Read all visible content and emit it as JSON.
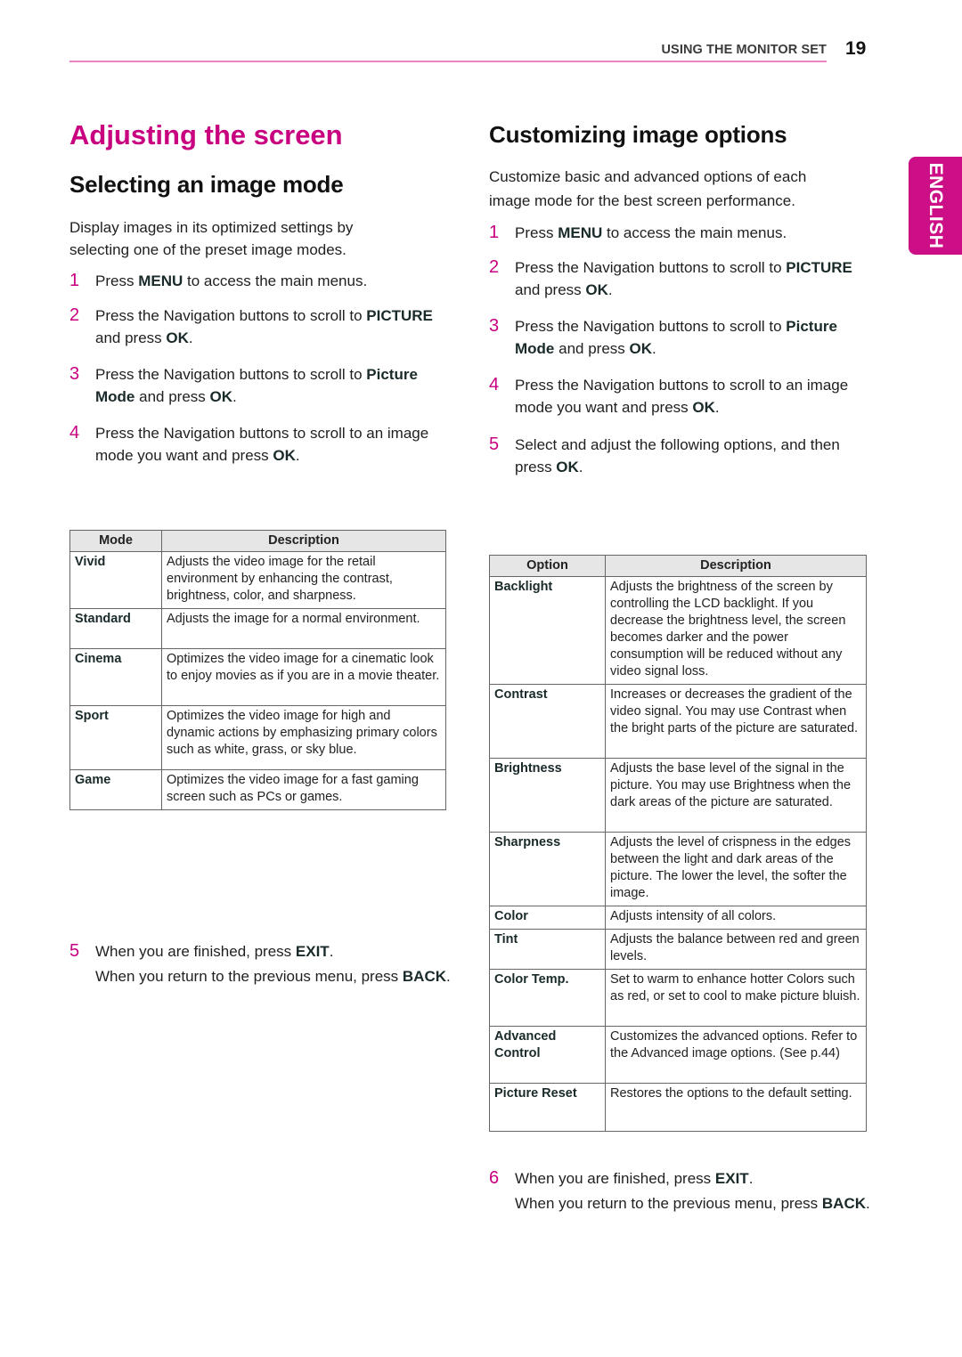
{
  "header": {
    "section": "USING THE MONITOR SET",
    "page_number": "19",
    "accent_color": "#c8007f",
    "rule_color": "#ee82c6"
  },
  "language_tab": "ENGLISH",
  "title": "Adjusting the screen",
  "left": {
    "heading": "Selecting an image mode",
    "intro": [
      "Display images in its optimized settings by",
      "selecting one of the preset image modes."
    ],
    "steps": [
      {
        "num": "1",
        "parts": [
          [
            "Press ",
            false
          ],
          [
            "MENU",
            true
          ],
          [
            " to access the main menus.",
            false
          ]
        ]
      },
      {
        "num": "2",
        "parts": [
          [
            "Press the Navigation buttons to scroll to ",
            false
          ],
          [
            "PICTURE",
            true
          ],
          [
            " and press ",
            false
          ],
          [
            "OK",
            true
          ],
          [
            ".",
            false
          ]
        ]
      },
      {
        "num": "3",
        "parts": [
          [
            "Press the Navigation buttons to scroll to ",
            false
          ],
          [
            "Picture Mode",
            true
          ],
          [
            " and press ",
            false
          ],
          [
            "OK",
            true
          ],
          [
            ".",
            false
          ]
        ]
      },
      {
        "num": "4",
        "parts": [
          [
            "Press the Navigation buttons to scroll to an image mode you want and press ",
            false
          ],
          [
            "OK",
            true
          ],
          [
            ".",
            false
          ]
        ]
      }
    ],
    "table": {
      "headers": [
        "Mode",
        "Description"
      ],
      "rows": [
        [
          "Vivid",
          "Adjusts the video image for the retail environment by enhancing the contrast, brightness, color, and sharpness."
        ],
        [
          "Standard",
          "Adjusts the image for a normal environment."
        ],
        [
          "Cinema",
          "Optimizes the video image for a cinematic look to enjoy movies as if you are in a movie theater."
        ],
        [
          "Sport",
          "Optimizes the video image for high and dynamic actions by emphasizing primary colors such as white, grass, or sky blue."
        ],
        [
          "Game",
          "Optimizes the video image for a fast gaming screen such as PCs or games."
        ]
      ]
    },
    "final_step": {
      "num": "5",
      "parts": [
        [
          "When you are finished, press ",
          false
        ],
        [
          "EXIT",
          true
        ],
        [
          ".",
          false
        ]
      ],
      "note_parts": [
        [
          "When you return to the previous menu, press ",
          false
        ],
        [
          "BACK",
          true
        ],
        [
          ".",
          false
        ]
      ]
    }
  },
  "right": {
    "heading": "Customizing image options",
    "intro": [
      "Customize basic and advanced options of each",
      "image mode for the best screen performance."
    ],
    "steps": [
      {
        "num": "1",
        "parts": [
          [
            "Press ",
            false
          ],
          [
            "MENU",
            true
          ],
          [
            " to access the main menus.",
            false
          ]
        ]
      },
      {
        "num": "2",
        "parts": [
          [
            "Press the Navigation buttons to scroll to ",
            false
          ],
          [
            "PICTURE",
            true
          ],
          [
            " and press ",
            false
          ],
          [
            "OK",
            true
          ],
          [
            ".",
            false
          ]
        ]
      },
      {
        "num": "3",
        "parts": [
          [
            "Press the Navigation buttons to scroll to ",
            false
          ],
          [
            "Picture Mode",
            true
          ],
          [
            " and press ",
            false
          ],
          [
            "OK",
            true
          ],
          [
            ".",
            false
          ]
        ]
      },
      {
        "num": "4",
        "parts": [
          [
            "Press the Navigation buttons to scroll to an image mode you want and press ",
            false
          ],
          [
            "OK",
            true
          ],
          [
            ".",
            false
          ]
        ]
      },
      {
        "num": "5",
        "parts": [
          [
            "Select and adjust the following options, and then press ",
            false
          ],
          [
            "OK",
            true
          ],
          [
            ".",
            false
          ]
        ]
      }
    ],
    "table": {
      "headers": [
        "Option",
        "Description"
      ],
      "rows": [
        [
          "Backlight",
          "Adjusts the brightness of the screen by controlling the LCD backlight. If you decrease the brightness level, the screen becomes darker and the power consumption will be reduced without any video signal loss."
        ],
        [
          "Contrast",
          "Increases or decreases the gradient of the video signal. You may use Contrast when the bright parts of the picture are saturated."
        ],
        [
          "Brightness",
          "Adjusts the base level of the signal in the picture. You may use Brightness when the dark areas of the picture are saturated."
        ],
        [
          "Sharpness",
          "Adjusts the level of crispness in the edges between the light and dark areas of the picture. The lower the level, the softer the image."
        ],
        [
          "Color",
          "Adjusts intensity of all colors."
        ],
        [
          "Tint",
          "Adjusts the balance between red and green levels."
        ],
        [
          "Color Temp.",
          "Set to warm to enhance hotter Colors such as red, or set to cool to make picture bluish."
        ],
        [
          "Advanced Control",
          "Customizes the advanced options. Refer to the Advanced image options. (See p.44)"
        ],
        [
          "Picture Reset",
          "Restores the options to the default setting."
        ]
      ]
    },
    "final_step": {
      "num": "6",
      "parts": [
        [
          "When you are finished, press ",
          false
        ],
        [
          "EXIT",
          true
        ],
        [
          ".",
          false
        ]
      ],
      "note_parts": [
        [
          "When you return to the previous menu, press ",
          false
        ],
        [
          "BACK",
          true
        ],
        [
          ".",
          false
        ]
      ]
    }
  }
}
